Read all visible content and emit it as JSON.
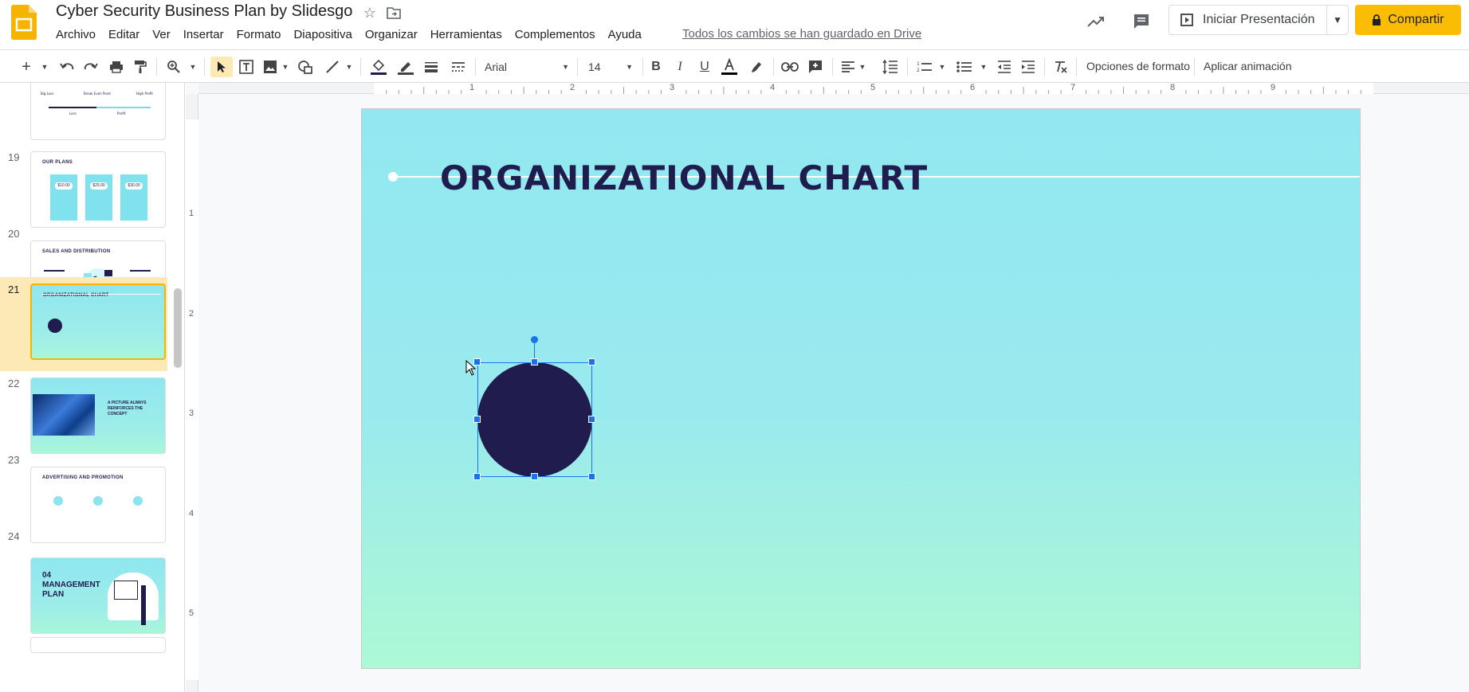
{
  "app": {
    "doc_title": "Cyber Security Business Plan by Slidesgo",
    "menu": [
      "Archivo",
      "Editar",
      "Ver",
      "Insertar",
      "Formato",
      "Diapositiva",
      "Organizar",
      "Herramientas",
      "Complementos",
      "Ayuda"
    ],
    "saved_status": "Todos los cambios se han guardado en Drive",
    "present_label": "Iniciar Presentación",
    "share_label": "Compartir"
  },
  "toolbar": {
    "font_name": "Arial",
    "font_size": "14",
    "format_options": "Opciones de formato",
    "apply_animation": "Aplicar animación"
  },
  "filmstrip": {
    "slides": [
      {
        "num": "19",
        "title": "OUR PLANS"
      },
      {
        "num": "20",
        "title": "SALES AND DISTRIBUTION"
      },
      {
        "num": "21",
        "title": "ORGANIZATIONAL CHART"
      },
      {
        "num": "22",
        "title": "A PICTURE ALWAYS REINFORCES THE CONCEPT"
      },
      {
        "num": "23",
        "title": "ADVERTISING AND PROMOTION"
      },
      {
        "num": "24",
        "title": "04 MANAGEMENT PLAN"
      }
    ],
    "partial_top_labels": [
      "Big Loss",
      "Break Even Point",
      "High Profit",
      "Loss",
      "Profit"
    ],
    "plan_prices": [
      "$10.00",
      "$25.00",
      "$30.00"
    ],
    "selected_index": 2
  },
  "ruler": {
    "h_marks": [
      "1",
      "2",
      "3",
      "4",
      "5",
      "6",
      "7",
      "8",
      "9"
    ],
    "v_marks": [
      "1",
      "2",
      "3",
      "4",
      "5"
    ]
  },
  "slide": {
    "title": "ORGANIZATIONAL CHART",
    "circle_color": "#211c4e"
  },
  "colors": {
    "accent_yellow": "#fbbc04",
    "selection_blue": "#1a73e8",
    "slide_bg_top": "#92e7f1",
    "slide_bg_bottom": "#acf9d6",
    "title_navy": "#1f1d4d"
  }
}
